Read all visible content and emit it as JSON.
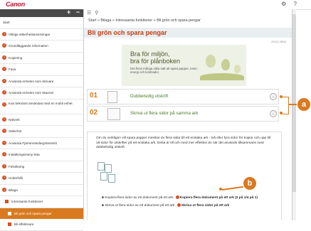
{
  "app": {
    "logo": "Canon"
  },
  "topbar": {
    "settings_icon": "gear-icon",
    "help_icon": "help-icon"
  },
  "sidebar": {
    "controls": {
      "expand": "+",
      "collapse": "−"
    },
    "items": [
      {
        "label": "Start"
      },
      {
        "label": "Viktiga säkerhetsanvisningar"
      },
      {
        "label": "Grundläggande information"
      },
      {
        "label": "Kopiering"
      },
      {
        "label": "Faxa"
      },
      {
        "label": "Använda enheten som skrivare"
      },
      {
        "label": "Använda enheten som skanner"
      },
      {
        "label": "Kan bekvämt användas med en mobil enhet"
      },
      {
        "label": "Nätverk"
      },
      {
        "label": "Säkerhet"
      },
      {
        "label": "Använda Fjärranvändargränssnitt"
      },
      {
        "label": "Inställningsmeny lista"
      },
      {
        "label": "Felsökning"
      },
      {
        "label": "Underhåll"
      },
      {
        "label": "Bilaga"
      },
      {
        "label": "Intressanta funktioner"
      },
      {
        "label": "Bli grön och spara pengar"
      },
      {
        "label": "Bli effektivare"
      }
    ]
  },
  "main": {
    "toolbar": {
      "menu_icon": "menu-icon",
      "search_icon": "search-icon"
    },
    "breadcrumb": "Start » Bilaga » Intressanta funktioner » Bli grön och spara pengar",
    "title": "Bli grön och spara pengar",
    "doc_id": "0YUC-6EW",
    "banner": {
      "line1": "Bra för miljön,",
      "line2": "bra för plånboken",
      "sub": "Det finns många olika sätt att spara papper, toner, energi och kostnader."
    },
    "cards": [
      {
        "num": "01",
        "label": "Dubbelsidig utskrift"
      },
      {
        "num": "02",
        "label": "Skriva ut flera sidor på samma ark"
      }
    ],
    "text": {
      "paragraph": "Om du verkligen vill spara papper minskar du flera sidor till ett enstaka ark - två eller fyra sidor för kopior och upp till 16 sidor för utskrifter på ett enstaka ark. Detta är till och med mer effektivt än när det används tillsammans med dubbelsidig utskrift.",
      "bullet1_pre": "Kopiera flera sidor av ett dokument på ett ark:",
      "bullet1_link": "Kopiera flera dokument på ett ark (2 på 1/4 på 1)",
      "bullet2_pre": "Skriva ut flera sidor av ett dokument på ett ark:",
      "bullet2_link": "Skriva ut flera sidor på ett ark"
    }
  },
  "callouts": {
    "a": "a",
    "b": "b"
  },
  "colors": {
    "accent": "#d97a1f",
    "title_red": "#c83a15",
    "nav_dot": "#d94f22",
    "link_green": "#4a7a2a"
  }
}
